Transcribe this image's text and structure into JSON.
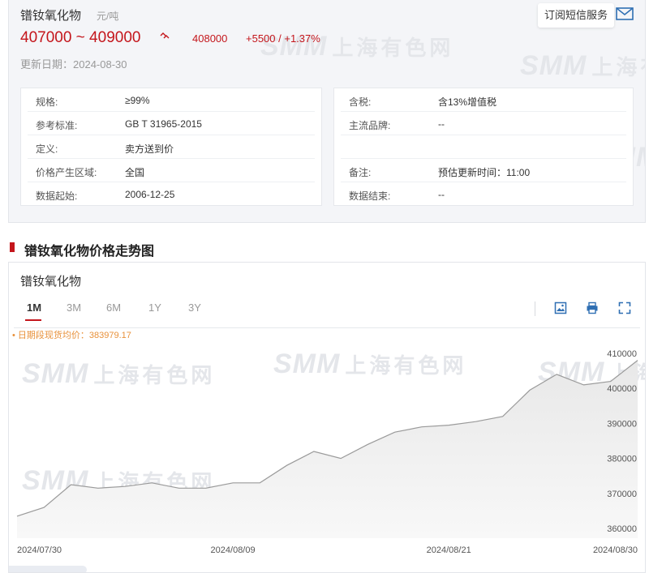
{
  "product": {
    "name": "镨钕氧化物",
    "unit": "元/吨"
  },
  "price": {
    "range": "407000 ~ 409000",
    "trend_icon": "up-arrows-icon",
    "average": "408000",
    "change": "+5500 / +1.37%"
  },
  "update": {
    "label": "更新日期：",
    "date": "2024-08-30"
  },
  "subscribe": {
    "label": "订阅短信服务",
    "icon": "mail-icon"
  },
  "watermark": {
    "brand": "SMM",
    "cn": "上海有色网"
  },
  "specs_left": [
    {
      "k": "规格:",
      "v": "≥99%"
    },
    {
      "k": "参考标准:",
      "v": "GB T 31965-2015"
    },
    {
      "k": "定义:",
      "v": "卖方送到价"
    },
    {
      "k": "价格产生区域:",
      "v": "全国"
    },
    {
      "k": "数据起始:",
      "v": "2006-12-25"
    }
  ],
  "specs_right": [
    {
      "k": "含税:",
      "v": "含13%增值税"
    },
    {
      "k": "主流品牌:",
      "v": "--"
    },
    {
      "k": "",
      "v": ""
    },
    {
      "k": "备注:",
      "v": "预估更新时间：11:00"
    },
    {
      "k": "数据结束:",
      "v": "--"
    }
  ],
  "section": {
    "title": "镨钕氧化物价格走势图"
  },
  "chart_panel": {
    "title": "镨钕氧化物",
    "tabs": [
      "1M",
      "3M",
      "6M",
      "1Y",
      "3Y"
    ],
    "active_tab": "1M",
    "tools": [
      "image-download-icon",
      "print-icon",
      "fullscreen-icon"
    ],
    "avg_note": "• 日期段现货均价：383979.17"
  },
  "colors": {
    "accent": "#c4161c",
    "line": "#9a9a9a",
    "area": "#e8e8e8",
    "note": "#e8913a"
  },
  "chart_data": {
    "type": "area",
    "x": [
      "2024-07-30",
      "2024-07-31",
      "2024-08-01",
      "2024-08-02",
      "2024-08-05",
      "2024-08-06",
      "2024-08-07",
      "2024-08-08",
      "2024-08-09",
      "2024-08-12",
      "2024-08-13",
      "2024-08-14",
      "2024-08-15",
      "2024-08-16",
      "2024-08-19",
      "2024-08-20",
      "2024-08-21",
      "2024-08-22",
      "2024-08-23",
      "2024-08-26",
      "2024-08-27",
      "2024-08-28",
      "2024-08-29",
      "2024-08-30"
    ],
    "values": [
      363500,
      366000,
      372500,
      371500,
      372000,
      373000,
      371500,
      371500,
      373000,
      373000,
      378000,
      382000,
      380000,
      384000,
      387500,
      389000,
      389500,
      390500,
      392000,
      399500,
      404000,
      401000,
      402000,
      408000
    ],
    "x_tick_labels": [
      {
        "index": 0,
        "label": "2024/07/30"
      },
      {
        "index": 8,
        "label": "2024/08/09"
      },
      {
        "index": 16,
        "label": "2024/08/21"
      },
      {
        "index": 23,
        "label": "2024/08/30"
      }
    ],
    "y_ticks": [
      360000,
      370000,
      380000,
      390000,
      400000,
      410000
    ],
    "ylim": [
      360000,
      410000
    ],
    "title": "镨钕氧化物",
    "legend": "none",
    "grid": false
  }
}
